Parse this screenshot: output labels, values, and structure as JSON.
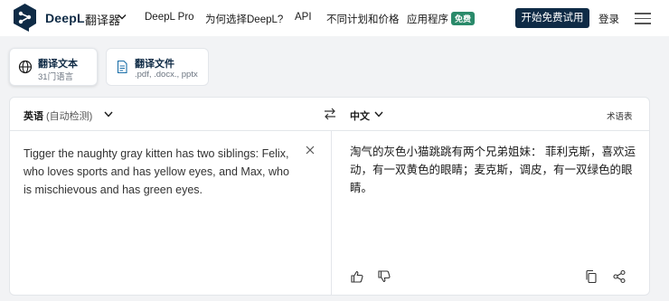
{
  "header": {
    "brand": "DeepL",
    "brand_sub": "翻译器",
    "nav": [
      "DeepL Pro",
      "为何选择DeepL?",
      "API",
      "不同计划和价格",
      "应用程序"
    ],
    "free_badge": "免费",
    "cta": "开始免费试用",
    "login": "登录"
  },
  "modes": [
    {
      "title": "翻译文本",
      "sub": "31门语言",
      "icon": "globe-icon"
    },
    {
      "title": "翻译文件",
      "sub": ".pdf, .docx., pptx",
      "icon": "document-icon"
    }
  ],
  "translator": {
    "source_lang": "英语",
    "source_auto": "(自动检测)",
    "target_lang": "中文",
    "glossary": "术语表",
    "source_text": "Tigger the naughty gray kitten has two siblings: Felix, who loves sports and has yellow eyes, and Max, who is mischievous and has green eyes.",
    "target_text": "淘气的灰色小猫跳跳有两个兄弟姐妹： 菲利克斯，喜欢运动，有一双黄色的眼睛；麦克斯，调皮，有一双绿色的眼睛。"
  },
  "colors": {
    "brand": "#0f2b46",
    "badge": "#2a8a6a"
  }
}
